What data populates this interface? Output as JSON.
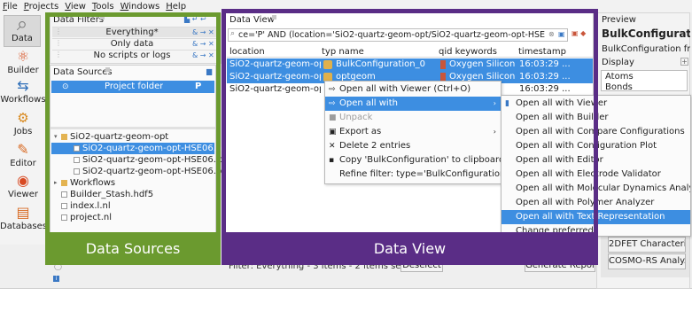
{
  "menubar": [
    "File",
    "Projects",
    "View",
    "Tools",
    "Windows",
    "Help"
  ],
  "toolbar": {
    "items": [
      {
        "label": "Data",
        "icon": "magnifier-icon"
      },
      {
        "label": "Builder",
        "icon": "builder-icon"
      },
      {
        "label": "Workflows",
        "icon": "workflows-icon"
      },
      {
        "label": "Jobs",
        "icon": "jobs-icon"
      },
      {
        "label": "Editor",
        "icon": "editor-icon"
      },
      {
        "label": "Viewer",
        "icon": "viewer-icon"
      },
      {
        "label": "Databases",
        "icon": "databases-icon"
      }
    ]
  },
  "data_filters": {
    "title": "Data Filters",
    "items": [
      "Everything*",
      "Only data",
      "No scripts or logs"
    ]
  },
  "data_sources": {
    "title": "Data Sources",
    "selected": "Project folder",
    "selected_badge": "P",
    "tree": [
      {
        "label": "SiO2-quartz-geom-opt",
        "kind": "folder",
        "indent": 0,
        "prefix": "▾"
      },
      {
        "label": "SiO2-quartz-geom-opt-HSE06.hdf5",
        "kind": "file",
        "indent": 1,
        "prefix": "",
        "selected": true
      },
      {
        "label": "SiO2-quartz-geom-opt-HSE06.log",
        "kind": "file",
        "indent": 1,
        "prefix": ""
      },
      {
        "label": "SiO2-quartz-geom-opt-HSE06.py",
        "kind": "file",
        "indent": 1,
        "prefix": ""
      },
      {
        "label": "Workflows",
        "kind": "folder",
        "indent": 0,
        "prefix": "▸"
      },
      {
        "label": "Builder_Stash.hdf5",
        "kind": "file",
        "indent": 0,
        "prefix": ""
      },
      {
        "label": "index.l.nl",
        "kind": "file",
        "indent": 0,
        "prefix": ""
      },
      {
        "label": "project.nl",
        "kind": "file",
        "indent": 0,
        "prefix": ""
      }
    ]
  },
  "data_view": {
    "title": "Data View",
    "filter_value": "ce='P' AND (location='SiO2-quartz-geom-opt/SiO2-quartz-geom-opt-HSE06.hdf5')",
    "columns": [
      "location",
      "typ name",
      "qid keywords",
      "timestamp"
    ],
    "rows": [
      {
        "location": "SiO2-quartz-geom-opt...",
        "name": "BulkConfiguration_0",
        "keywords": "Oxygen Silicon LCAO...",
        "timestamp": "16:03:29 ..."
      },
      {
        "location": "SiO2-quartz-geom-op...",
        "name": "optgeom",
        "keywords": "Oxygen Silicon LCAO...",
        "timestamp": "16:03:29 ..."
      },
      {
        "location": "SiO2-quartz-geom-op...",
        "name": "",
        "keywords": "",
        "timestamp": "16:03:29 ..."
      }
    ],
    "status": "Filter: Everything - 3 items - 2 items selected",
    "deselect": "Deselect",
    "generate_report": "Generate Report..."
  },
  "context_menu": {
    "items": [
      {
        "label": "Open all with Viewer (Ctrl+O)",
        "state": "normal",
        "icon": "⇨"
      },
      {
        "label": "Open all with",
        "state": "highlight",
        "icon": "⇨",
        "submenu": true
      },
      {
        "label": "Unpack",
        "state": "disabled",
        "icon": "■"
      },
      {
        "label": "Export as",
        "state": "normal",
        "icon": "▣",
        "submenu": true
      },
      {
        "label": "Delete 2 entries",
        "state": "normal",
        "icon": "✕"
      },
      {
        "label": "Copy 'BulkConfiguration' to clipboard",
        "state": "normal",
        "icon": "▪"
      },
      {
        "label": "Refine filter: type='BulkConfiguration'",
        "state": "normal",
        "icon": ""
      }
    ]
  },
  "submenu": {
    "items": [
      {
        "label": "Open all with Viewer",
        "state": "normal"
      },
      {
        "label": "Open all with Builder",
        "state": "normal"
      },
      {
        "label": "Open all with Compare Configurations",
        "state": "normal"
      },
      {
        "label": "Open all with Configuration Plot",
        "state": "normal"
      },
      {
        "label": "Open all with Editor",
        "state": "normal"
      },
      {
        "label": "Open all with Electrode Validator",
        "state": "normal"
      },
      {
        "label": "Open all with Molecular Dynamics Analyzer",
        "state": "normal"
      },
      {
        "label": "Open all with Polymer Analyzer",
        "state": "normal"
      },
      {
        "label": "Open all with Text Representation",
        "state": "highlight"
      },
      {
        "label": "Change preferred",
        "state": "normal"
      }
    ]
  },
  "preview": {
    "title": "Preview",
    "heading": "BulkConfigurati...",
    "subtitle": "BulkConfiguration fr...",
    "display_label": "Display",
    "list": [
      "Atoms",
      "Bonds"
    ],
    "bottom_items": [
      "2DFET Characteri...",
      "COSMO-RS Analy..."
    ]
  },
  "overlays": {
    "data_sources": "Data Sources",
    "data_view": "Data View"
  },
  "colors": {
    "selection": "#3d8ee1",
    "overlay_green": "#6b9a2f",
    "overlay_purple": "#5a2d86"
  }
}
